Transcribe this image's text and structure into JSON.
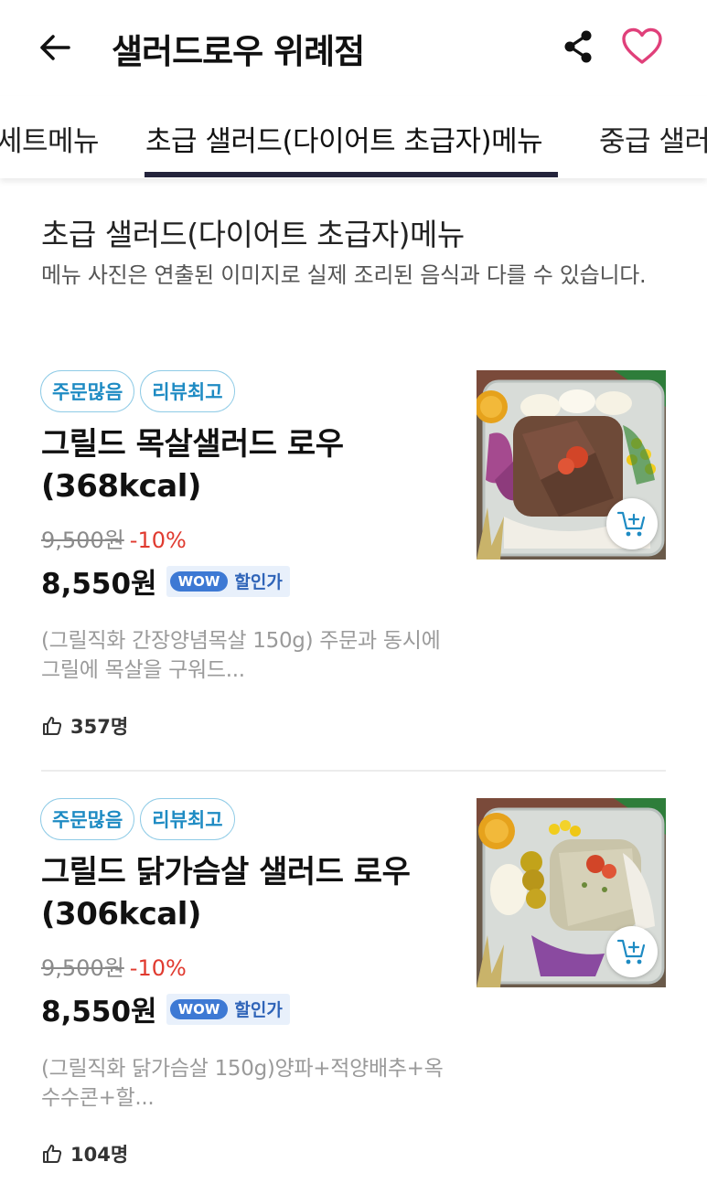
{
  "header": {
    "title": "샐러드로우 위례점",
    "icons": [
      "back-arrow-icon",
      "share-icon",
      "heart-icon"
    ],
    "heart_color": "#e0407a"
  },
  "tabs": [
    {
      "label": "세트메뉴"
    },
    {
      "label": "초급 샐러드(다이어트 초급자)메뉴",
      "active": true
    },
    {
      "label": "중급 샐러"
    }
  ],
  "section": {
    "title": "초급 샐러드(다이어트 초급자)메뉴",
    "description": "메뉴 사진은 연출된 이미지로 실제 조리된 음식과 다를 수 있습니다."
  },
  "products": [
    {
      "badges": [
        "주문많음",
        "리뷰최고"
      ],
      "name": "그릴드 목살샐러드 로우(368kcal)",
      "original_price": "9,500원",
      "discount": "-10%",
      "price": "8,550원",
      "wow_label": "WOW",
      "wow_text": "할인가",
      "description": "(그릴직화 간장양념목살 150g) 주문과 동시에 그릴에 목살을 구워드...",
      "likes": "357명"
    },
    {
      "badges": [
        "주문많음",
        "리뷰최고"
      ],
      "name": "그릴드 닭가슴살 샐러드 로우(306kcal)",
      "original_price": "9,500원",
      "discount": "-10%",
      "price": "8,550원",
      "wow_label": "WOW",
      "wow_text": "할인가",
      "description": "(그릴직화 닭가슴살 150g)양파+적양배추+옥수수콘+할...",
      "likes": "104명"
    }
  ],
  "colors": {
    "badge_text": "#1e8bc3",
    "discount": "#e03a2f",
    "wow": "#3d79d4",
    "tab_underline": "#24243c"
  }
}
